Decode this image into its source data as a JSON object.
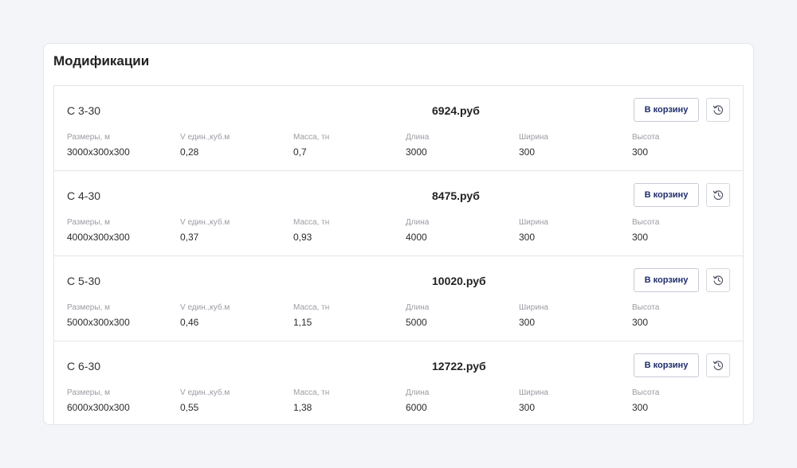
{
  "section": {
    "title": "Модификации"
  },
  "buttons": {
    "cart_label": "В корзину"
  },
  "icons": {
    "history": "history-icon"
  },
  "attr_labels": [
    "Размеры, м",
    "V един.,куб.м",
    "Масса, тн",
    "Длина",
    "Ширина",
    "Высота"
  ],
  "items": [
    {
      "name": "С 3-30",
      "price": "6924.руб",
      "values": [
        "3000х300х300",
        "0,28",
        "0,7",
        "3000",
        "300",
        "300"
      ]
    },
    {
      "name": "С 4-30",
      "price": "8475.руб",
      "values": [
        "4000х300х300",
        "0,37",
        "0,93",
        "4000",
        "300",
        "300"
      ]
    },
    {
      "name": "С 5-30",
      "price": "10020.руб",
      "values": [
        "5000х300х300",
        "0,46",
        "1,15",
        "5000",
        "300",
        "300"
      ]
    },
    {
      "name": "С 6-30",
      "price": "12722.руб",
      "values": [
        "6000х300х300",
        "0,55",
        "1,38",
        "6000",
        "300",
        "300"
      ]
    }
  ],
  "colors": {
    "accent": "#1f2e6b",
    "border": "#e3e5ea",
    "muted": "#9a9ca3"
  }
}
